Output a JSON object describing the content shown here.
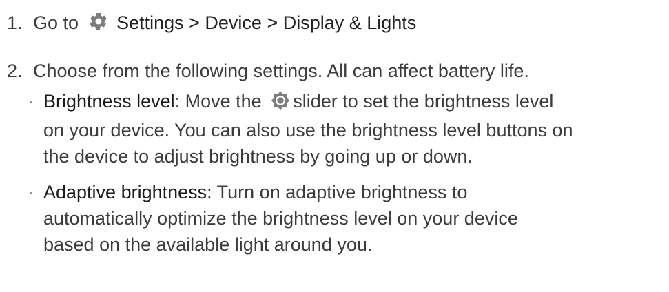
{
  "steps": [
    {
      "number": "1.",
      "prefix": "Go to",
      "icon": "gear-icon",
      "path": "Settings > Device > Display & Lights"
    },
    {
      "number": "2.",
      "text": "Choose from the following settings. All can affect battery life."
    }
  ],
  "bullets": [
    {
      "term": "Brightness level",
      "sep": ":",
      "line1_before_icon": " Move the",
      "icon": "brightness-icon",
      "line1_after_icon": "slider to set the brightness level",
      "line2": "on your  device. You can also use the brightness level buttons on",
      "line3": "the device to adjust brightness by going up or down."
    },
    {
      "term": "Adaptive brightness:",
      "line1_rest": " Turn on adaptive brightness to",
      "line2": "automatically optimize the brightness level on your device",
      "line3": "based on the available light around you."
    }
  ],
  "colors": {
    "text": "#3c3c3c",
    "icon": "#7d7d7d"
  }
}
